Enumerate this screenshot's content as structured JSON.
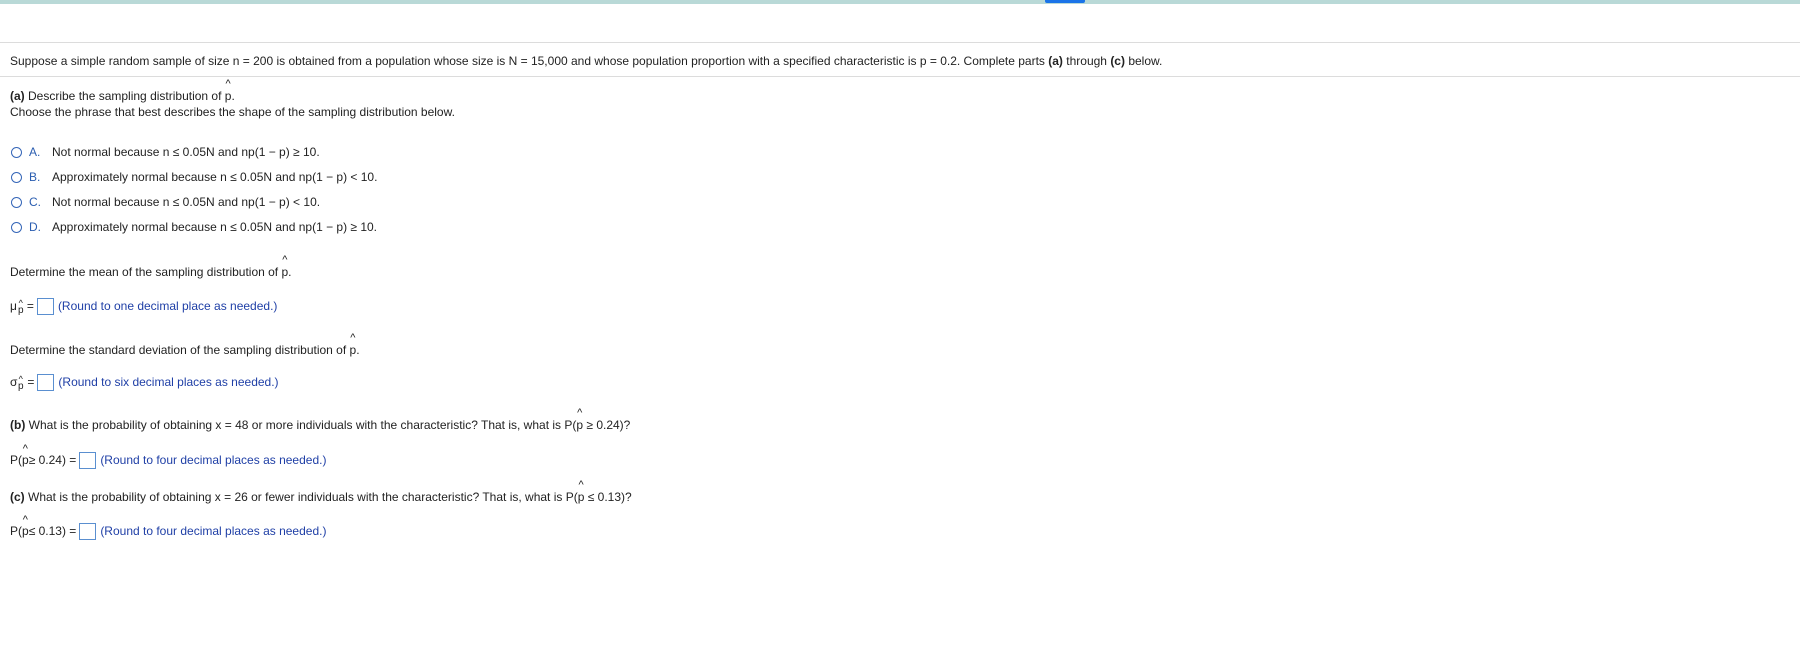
{
  "intro": {
    "text_a": "Suppose a simple random sample of size n = 200 is obtained from a population whose size is N = 15,000 and whose population proportion with a specified characteristic is p = 0.2. Complete parts ",
    "part_a": "(a)",
    "through": " through ",
    "part_c": "(c)",
    "text_b": " below."
  },
  "part_a": {
    "label": "(a)",
    "title": " Describe the sampling distribution of ",
    "instruction": "Choose the phrase that best describes the shape of the sampling distribution below.",
    "options": [
      {
        "letter": "A.",
        "text": "Not normal because n ≤ 0.05N and np(1 − p) ≥ 10."
      },
      {
        "letter": "B.",
        "text": "Approximately normal because n ≤ 0.05N and np(1 − p) < 10."
      },
      {
        "letter": "C.",
        "text": "Not normal because n ≤ 0.05N and np(1 − p) < 10."
      },
      {
        "letter": "D.",
        "text": "Approximately normal because n ≤ 0.05N and np(1 − p) ≥ 10."
      }
    ],
    "mean_prompt": "Determine the mean of the sampling distribution of ",
    "mean_symbol": "μ",
    "mean_hint": "(Round to one decimal place as needed.)",
    "sd_prompt": "Determine the standard deviation of the sampling distribution of ",
    "sd_symbol": "σ",
    "sd_hint": "(Round to six decimal places as needed.)"
  },
  "part_b": {
    "label": "(b)",
    "question": " What is the probability of obtaining x = 48 or more individuals with the characteristic? That is, what is P(",
    "question_end": " ≥ 0.24)?",
    "answer_prefix": "P(",
    "answer_suffix": " ≥ 0.24) =",
    "hint": "(Round to four decimal places as needed.)"
  },
  "part_c": {
    "label": "(c)",
    "question": " What is the probability of obtaining x = 26 or fewer individuals with the characteristic? That is, what is P(",
    "question_end": " ≤ 0.13)?",
    "answer_prefix": "P(",
    "answer_suffix": " ≤ 0.13) =",
    "hint": "(Round to four decimal places as needed.)"
  },
  "p_hat": "p",
  "period": ".",
  "equals": "="
}
